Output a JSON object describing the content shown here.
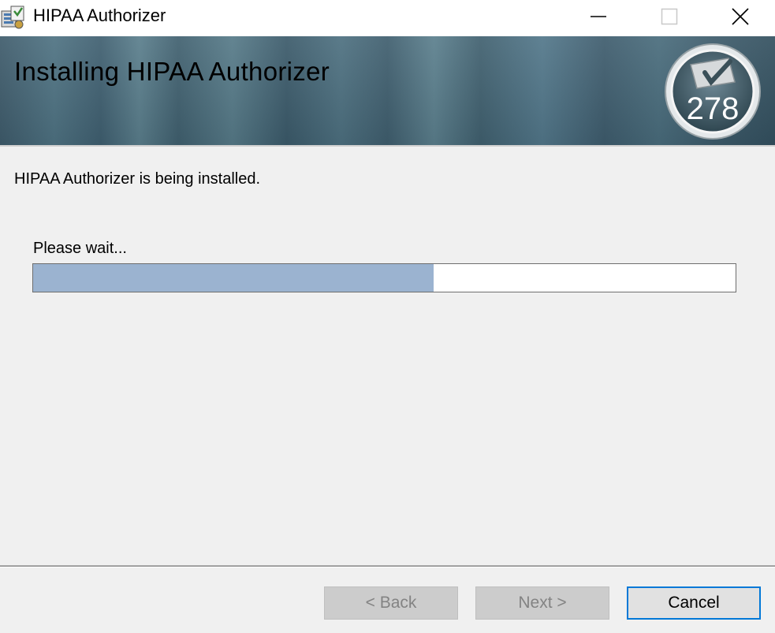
{
  "window": {
    "title": "HIPAA Authorizer"
  },
  "banner": {
    "title": "Installing HIPAA Authorizer",
    "badge_number": "278"
  },
  "content": {
    "status_text": "HIPAA Authorizer is being installed.",
    "wait_text": "Please wait...",
    "progress_fraction": 0.57
  },
  "buttons": {
    "back": "< Back",
    "next": "Next >",
    "cancel": "Cancel"
  },
  "colors": {
    "progress_fill": "#9bb3d0",
    "accent": "#0078d7"
  }
}
